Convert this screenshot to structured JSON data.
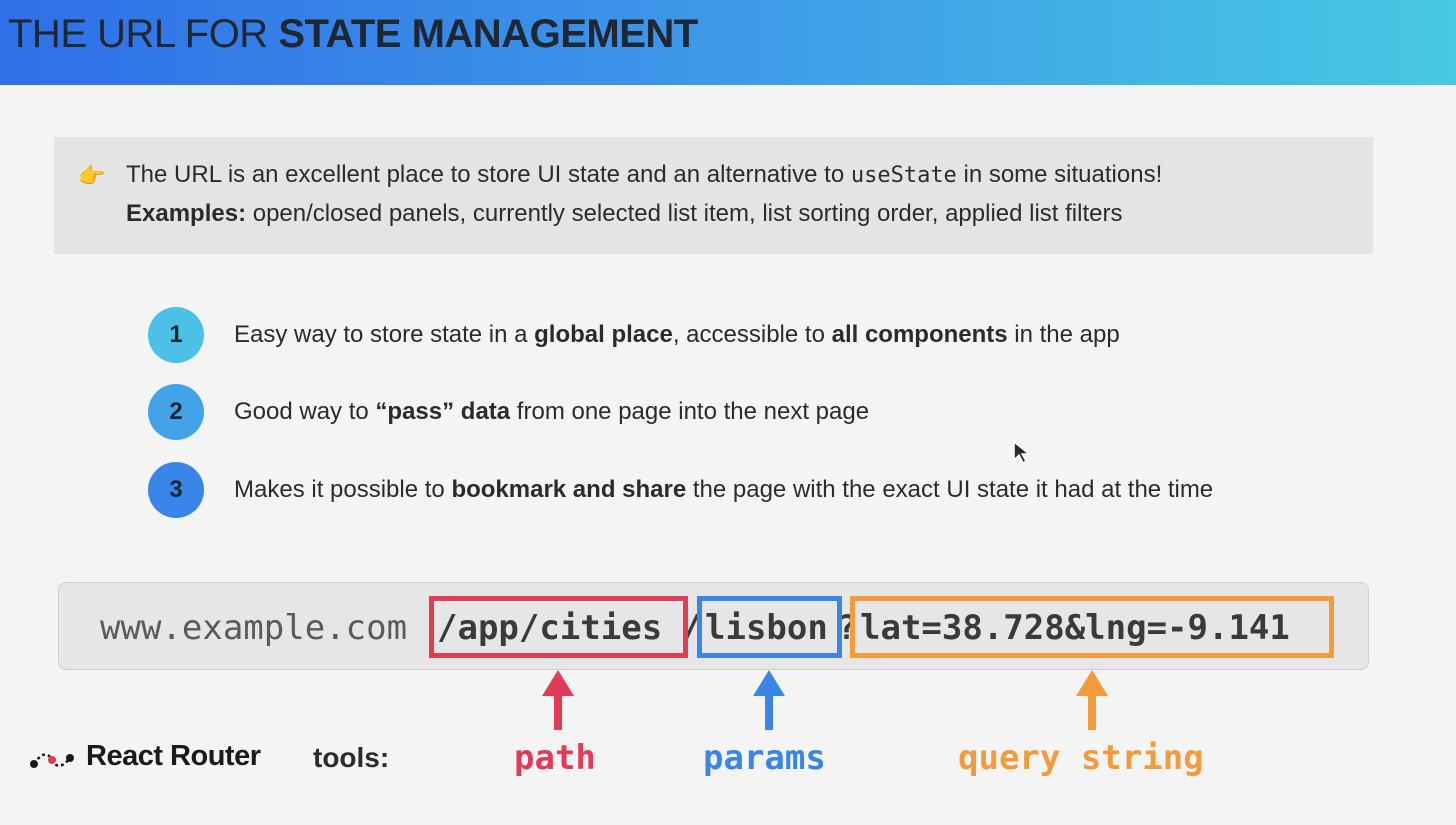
{
  "header": {
    "title_light": "THE URL FOR ",
    "title_bold": "STATE MANAGEMENT"
  },
  "callout": {
    "icon": "pointing-hand-icon",
    "line1_a": "The URL is an excellent place to store UI state and an alternative to ",
    "line1_code": "useState",
    "line1_b": " in some situations!",
    "line2_bold": "Examples:",
    "line2_rest": " open/closed panels, currently selected list item, list sorting order, applied list filters"
  },
  "points": [
    {
      "number": "1",
      "color": "#4cc0e6",
      "t1": "Easy way to store state in a ",
      "b1": "global place",
      "t2": ", accessible to ",
      "b2": "all components",
      "t3": " in the app"
    },
    {
      "number": "2",
      "color": "#42a3e8",
      "t1": "Good way to ",
      "b1": "“pass” data",
      "t2": " from one page into the next page"
    },
    {
      "number": "3",
      "color": "#3a86e8",
      "t1": "Makes it possible to ",
      "b1": "bookmark and share",
      "t2": " the page with the exact UI state it had at the time"
    }
  ],
  "url": {
    "domain": "www.example.com",
    "path": "/app/cities",
    "separator": "/",
    "param": "lisbon",
    "question": "?",
    "query": "lat=38.728&lng=-9.141"
  },
  "labels": {
    "path": "path",
    "params": "params",
    "query": "query string"
  },
  "colors": {
    "path": "#e23b57",
    "params": "#3a86e8",
    "query": "#f39a3a"
  },
  "footer": {
    "brand": "React Router",
    "tools": "tools:"
  }
}
